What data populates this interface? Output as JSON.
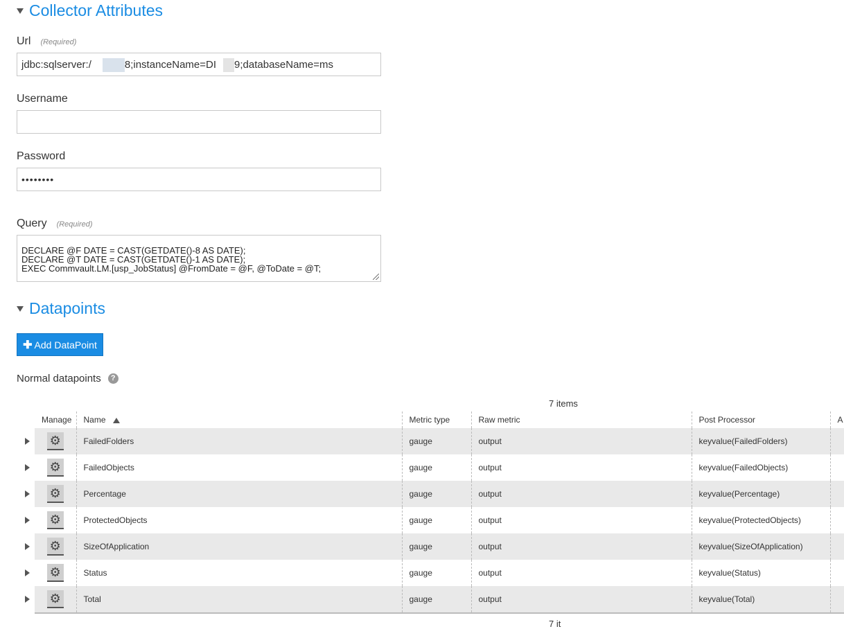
{
  "collector": {
    "title": "Collector Attributes",
    "url_label": "Url",
    "url_required": "(Required)",
    "url_value_a": "jdbc:sqlserver:/",
    "url_value_b": "8;instanceName=DI",
    "url_value_c": "9;databaseName=ms",
    "username_label": "Username",
    "username_value": "",
    "password_label": "Password",
    "password_value": "••••••••",
    "query_label": "Query",
    "query_required": "(Required)",
    "query_lines": [
      "DECLARE @F DATE = CAST(GETDATE()-8 AS DATE);",
      "DECLARE @T DATE = CAST(GETDATE()-1 AS DATE);",
      "EXEC Commvault.LM.[usp_JobStatus] @FromDate = @F, @ToDate = @T;"
    ]
  },
  "datapoints": {
    "title": "Datapoints",
    "add_button": "Add DataPoint",
    "normal_label": "Normal datapoints",
    "help_glyph": "?",
    "items_count": "7 items",
    "items_count_bottom": "7 it",
    "columns": [
      "Manage",
      "Name",
      "Metric type",
      "Raw metric",
      "Post Processor",
      "A"
    ],
    "rows": [
      {
        "name": "FailedFolders",
        "metric_type": "gauge",
        "raw_metric": "output",
        "post_processor": "keyvalue(FailedFolders)"
      },
      {
        "name": "FailedObjects",
        "metric_type": "gauge",
        "raw_metric": "output",
        "post_processor": "keyvalue(FailedObjects)"
      },
      {
        "name": "Percentage",
        "metric_type": "gauge",
        "raw_metric": "output",
        "post_processor": "keyvalue(Percentage)"
      },
      {
        "name": "ProtectedObjects",
        "metric_type": "gauge",
        "raw_metric": "output",
        "post_processor": "keyvalue(ProtectedObjects)"
      },
      {
        "name": "SizeOfApplication",
        "metric_type": "gauge",
        "raw_metric": "output",
        "post_processor": "keyvalue(SizeOfApplication)"
      },
      {
        "name": "Status",
        "metric_type": "gauge",
        "raw_metric": "output",
        "post_processor": "keyvalue(Status)"
      },
      {
        "name": "Total",
        "metric_type": "gauge",
        "raw_metric": "output",
        "post_processor": "keyvalue(Total)"
      }
    ]
  },
  "icons": {
    "collapse": "caret-down-icon",
    "add": "plus-icon",
    "help": "help-icon",
    "manage": "gear-icon",
    "expand": "caret-right-icon",
    "sort": "sort-asc-icon"
  },
  "colors": {
    "accent": "#1a8ce3",
    "row_shade": "#e9e9e9"
  }
}
